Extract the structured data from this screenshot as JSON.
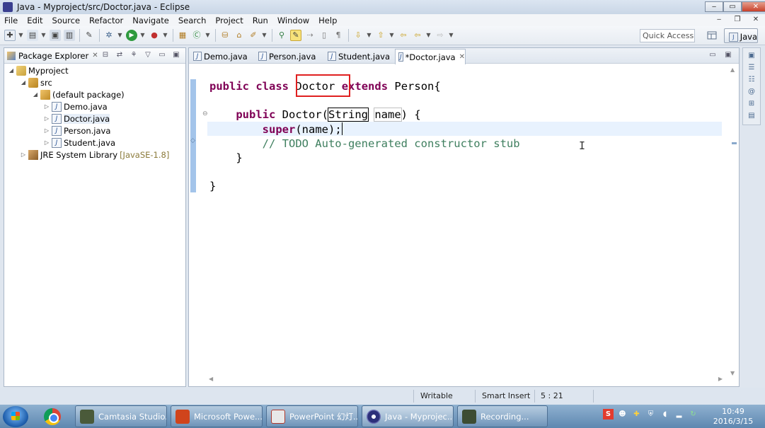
{
  "window": {
    "title": "Java - Myproject/src/Doctor.java - Eclipse",
    "controls": {
      "minimize": "‒",
      "maximize": "▭",
      "close": "✕"
    }
  },
  "menubar": {
    "items": [
      "File",
      "Edit",
      "Source",
      "Refactor",
      "Navigate",
      "Search",
      "Project",
      "Run",
      "Window",
      "Help"
    ],
    "controls": {
      "minimize": "‒",
      "restore": "❐",
      "close": "✕"
    }
  },
  "toolbar": {
    "quick_access_placeholder": "Quick Access",
    "perspective_label": "Java"
  },
  "package_explorer": {
    "title": "Package Explorer",
    "tree": {
      "project": "Myproject",
      "src": "src",
      "package": "(default package)",
      "files": [
        "Demo.java",
        "Doctor.java",
        "Person.java",
        "Student.java"
      ],
      "library": "JRE System Library",
      "library_version": "[JavaSE-1.8]"
    }
  },
  "editor": {
    "tabs": [
      "Demo.java",
      "Person.java",
      "Student.java",
      "*Doctor.java"
    ],
    "active_tab": "*Doctor.java",
    "code": {
      "line1_kw1": "public",
      "line1_kw2": "class",
      "line1_name": "Doctor",
      "line1_kw3": "extends",
      "line1_rest": "Person{",
      "line3_kw": "public",
      "line3_ctor": "Doctor(",
      "line3_type": "String",
      "line3_param": "name",
      "line3_end": ") {",
      "line4_kw": "super",
      "line4_rest": "(name);",
      "line5_comment": "// TODO Auto-generated constructor stub",
      "line6": "}",
      "line8": "}"
    }
  },
  "statusbar": {
    "mode": "Writable",
    "insert": "Smart Insert",
    "position": "5 : 21"
  },
  "taskbar": {
    "tasks": [
      "Camtasia Studio...",
      "Microsoft Powe...",
      "PowerPoint 幻灯...",
      "Java - Myprojec...",
      "Recording..."
    ],
    "time": "10:49",
    "date": "2016/3/15"
  }
}
